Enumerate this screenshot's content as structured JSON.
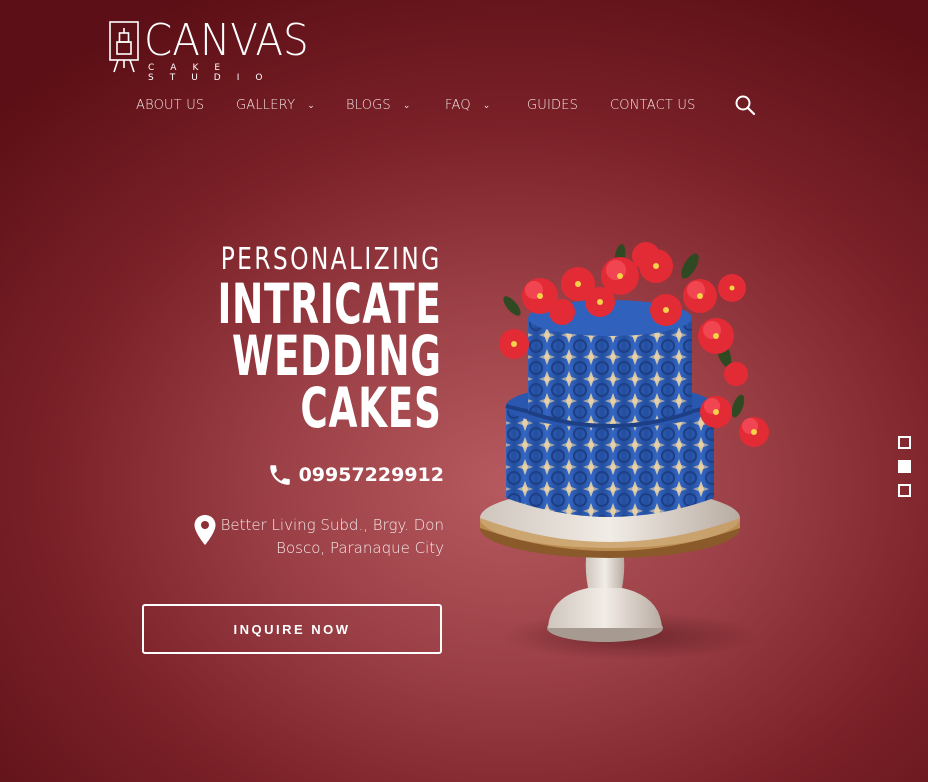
{
  "brand": {
    "name": "CANVAS",
    "tagline": "CAKE STUDIO"
  },
  "nav": {
    "items": [
      {
        "label": "ABOUT US",
        "dropdown": false
      },
      {
        "label": "GALLERY",
        "dropdown": true
      },
      {
        "label": "BLOGS",
        "dropdown": true
      },
      {
        "label": "FAQ",
        "dropdown": true
      },
      {
        "label": "GUIDES",
        "dropdown": false
      },
      {
        "label": "CONTACT US",
        "dropdown": false
      }
    ],
    "chevron": "⌄"
  },
  "hero": {
    "line1": "PERSONALIZING",
    "line2": "INTRICATE",
    "line3": "WEDDING",
    "line4": "CAKES"
  },
  "contact": {
    "phone": "09957229912",
    "address_line1": "Better Living Subd., Brgy. Don",
    "address_line2": "Bosco, Paranaque City"
  },
  "cta": {
    "label": "INQUIRE NOW"
  },
  "slider": {
    "count": 3,
    "active_index": 1
  },
  "icons": {
    "search": "search-icon",
    "phone": "phone-icon",
    "pin": "location-pin-icon",
    "logo": "easel-cake-icon"
  },
  "colors": {
    "background": "#8a2c33",
    "text": "#ffffff",
    "cake_blue": "#2f5fb8",
    "flower_red": "#e8303a"
  }
}
